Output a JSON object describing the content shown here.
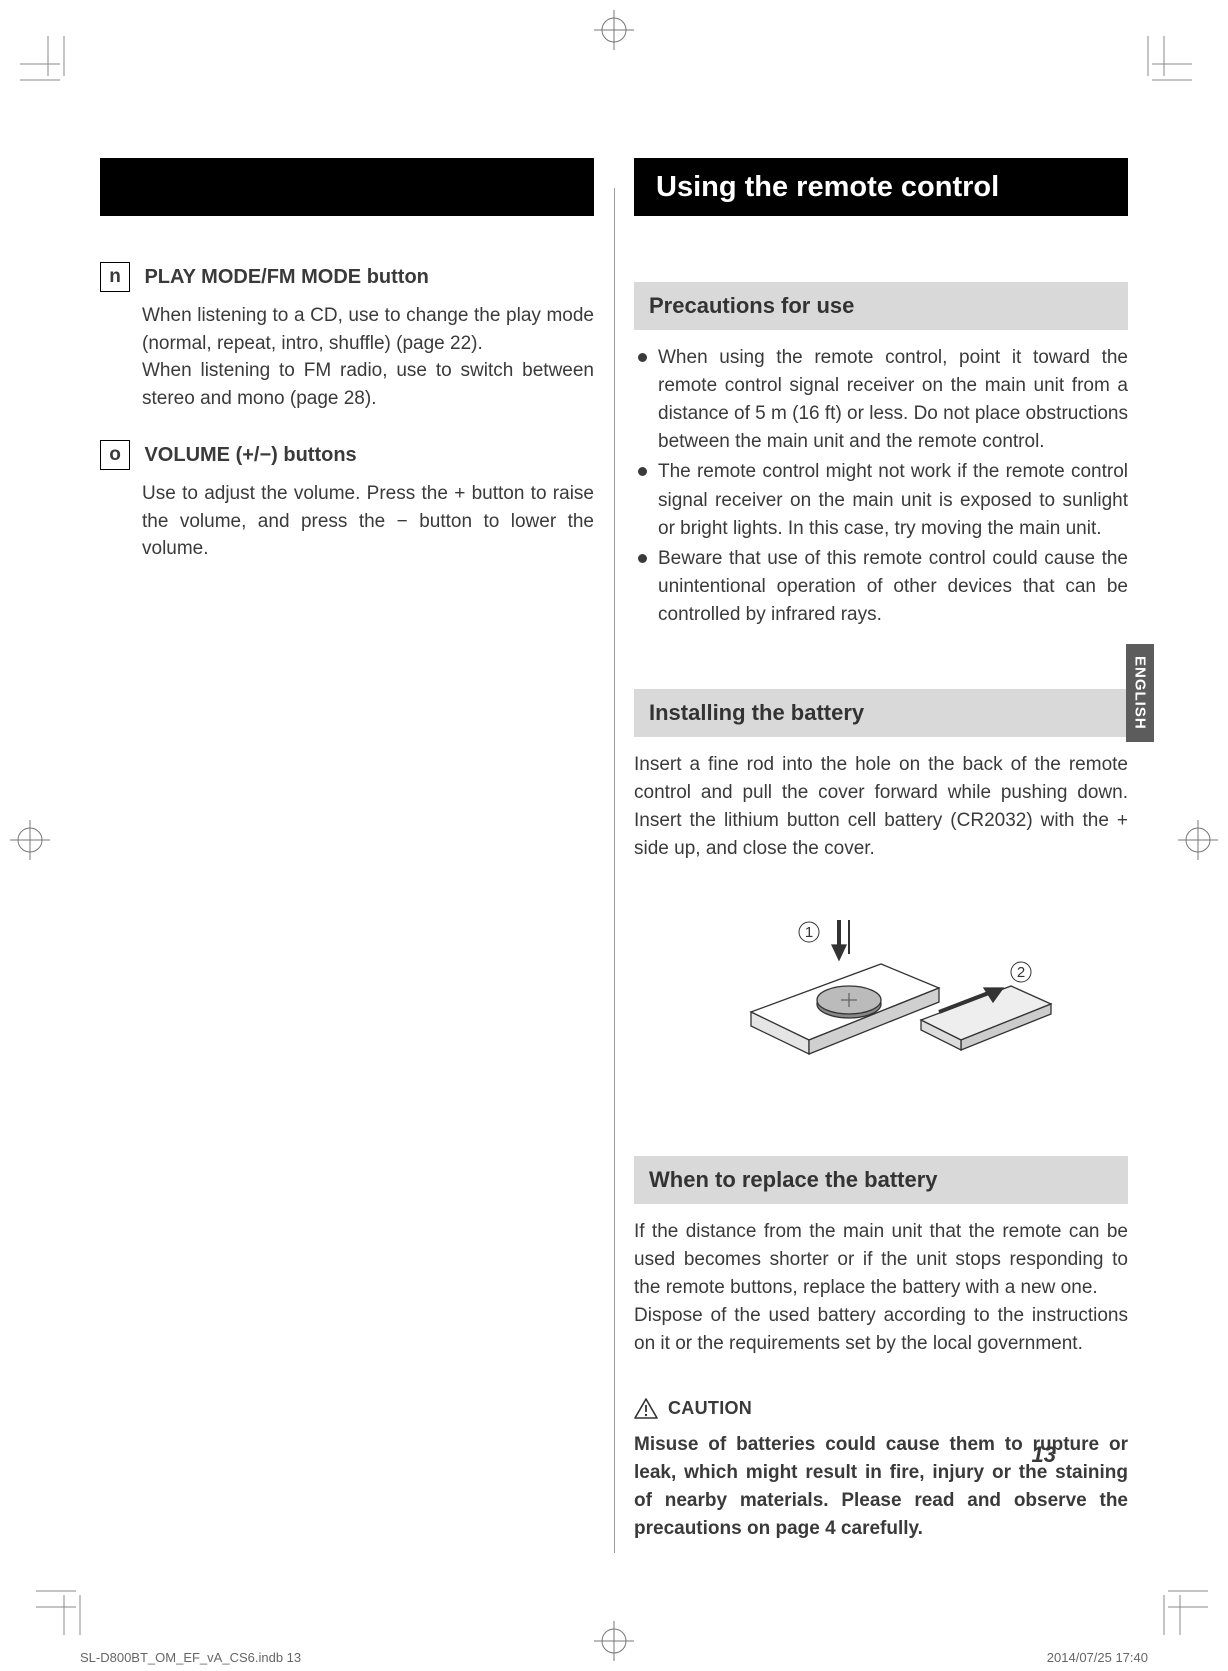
{
  "left": {
    "items": [
      {
        "letter": "n",
        "title": "PLAY MODE/FM MODE button",
        "body": "When listening to a CD, use to change the play mode (normal, repeat, intro, shuffle) (page 22).\nWhen listening to FM radio, use to switch between stereo and mono (page 28)."
      },
      {
        "letter": "o",
        "title": "VOLUME (+/−) buttons",
        "body": "Use to adjust the volume. Press the + button to raise the volume, and press the − button to lower the volume."
      }
    ]
  },
  "right": {
    "main_heading": "Using the remote control",
    "precautions": {
      "heading": "Precautions for use",
      "bullets": [
        "When using the remote control, point it toward the remote control signal receiver on the main unit from a distance of 5 m (16 ft) or less. Do not place obstructions between the main unit and the remote control.",
        "The remote control might not work if the remote control signal receiver on the main unit is exposed to sunlight or bright lights. In this case, try moving the main unit.",
        "Beware that use of this remote control could cause the unintentional operation of other devices that can be controlled by infrared rays."
      ]
    },
    "installing": {
      "heading": "Installing the battery",
      "body": "Insert a fine rod into the hole on the back of the remote control and pull the cover forward while pushing down. Insert the lithium button cell battery (CR2032) with the + side up, and close the cover.",
      "callout_1": "1",
      "callout_2": "2"
    },
    "replace": {
      "heading": "When to replace the battery",
      "body": "If the distance from the main unit that the remote can be used becomes shorter or if the unit stops responding to the remote buttons, replace the battery with a new one.\nDispose of the used battery according to the instructions on it or the requirements set by the local government."
    },
    "caution": {
      "label": "CAUTION",
      "body": "Misuse of batteries could cause them to rupture or leak, which might result in fire, injury or the staining of nearby materials. Please read and observe the precautions on page 4 carefully."
    }
  },
  "lang_tab": "ENGLISH",
  "page_number": "13",
  "footer": {
    "left": "SL-D800BT_OM_EF_vA_CS6.indb   13",
    "right": "2014/07/25   17:40"
  }
}
